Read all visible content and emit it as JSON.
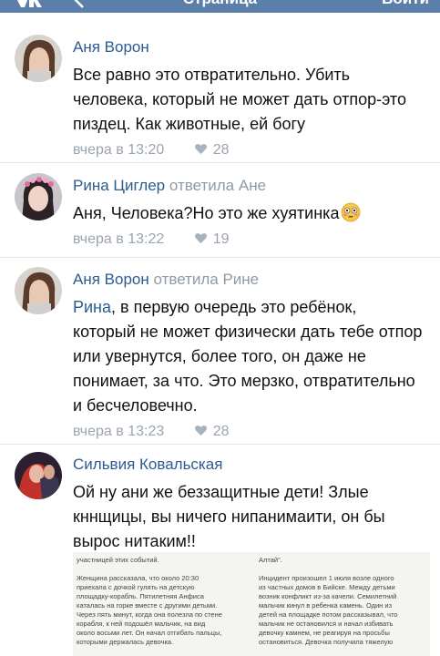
{
  "header": {
    "title": "Страница",
    "action": "Войти"
  },
  "comments": [
    {
      "author": "Аня Ворон",
      "reply_to": "",
      "mention": "",
      "text": "Все равно это отвратительно. Убить человека, который не может дать отпор-это пиздец. Как животные, ей богу",
      "time": "вчера в 13:20",
      "likes": "28"
    },
    {
      "author": "Рина Циглер",
      "reply_to": "ответила Ане",
      "mention": "",
      "text": "Аня, Человека?Но это же хуятинка",
      "emoji": "flushed-face",
      "time": "вчера в 13:22",
      "likes": "19"
    },
    {
      "author": "Аня Ворон",
      "reply_to": "ответила Рине",
      "mention": "Рина",
      "text": ", в первую очередь это ребёнок, который не может физически дать тебе отпор или увернутся, более того, он даже не понимает, за что. Это мерзко, отвратительно и бесчеловечно.",
      "time": "вчера в 13:23",
      "likes": "28"
    },
    {
      "author": "Сильвия Ковальская",
      "reply_to": "",
      "mention": "",
      "text": "Ой ну ани же беззащитные дети! Злые кннщицы, вы ничего нипанимаити, он бы вырос нитаким!!",
      "time": "",
      "likes": ""
    }
  ],
  "attachment": {
    "left_text": "участницей этих событий.\n\nЖенщина рассказала, что около 20:30\nприехала с дочкой гулять на детскую\nплощадку-корабль. Пятилетняя Анфиса\nкаталась на горке вместе с другими детьми.\nЧерез пять минут, когда она полезла по стене\nкорабля, к ней подошёл мальчик, на вид\nоколо восьми лет. Он начал отгибать пальцы,\nкоторыми держалась девочка.",
    "right_text": "Алтай\".\n\nИнцидент произошел 1 июля возле одного\nиз частных домов в Бийске. Между детьми\nвозник конфликт из-за качели. Семилетний\nмальчик кинул в ребенка камень. Один из\nдетей на площадке потом рассказывал, что\nмальчик не остановился и начал избивать\nдевочку камнем, не реагируя на просьбы\nостановиться. Девочка получила тяжелую"
  },
  "colors": {
    "header_bg": "#5b7fa8",
    "author": "#2b5b8f",
    "meta": "#9aa4ae",
    "divider": "#e3e6ea"
  }
}
